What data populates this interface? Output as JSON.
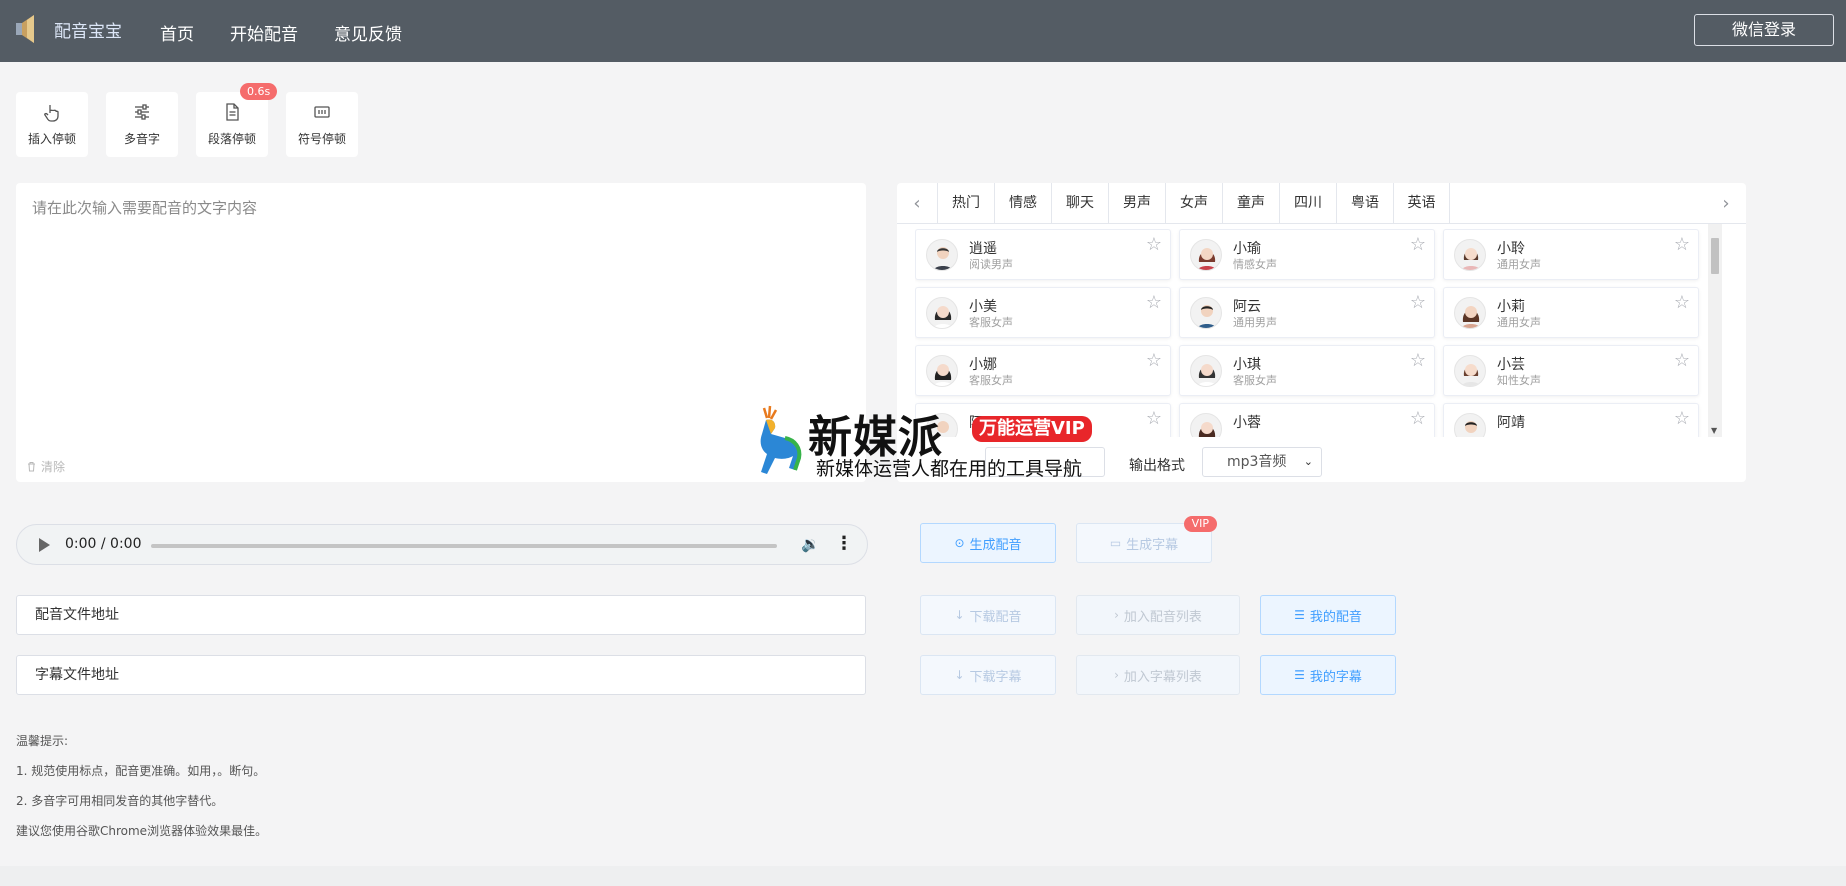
{
  "app": {
    "name": "配音宝宝",
    "nav": [
      "首页",
      "开始配音",
      "意见反馈"
    ],
    "login_label": "微信登录"
  },
  "tools": [
    {
      "label": "插入停顿",
      "icon": "hand-pointer-icon"
    },
    {
      "label": "多音字",
      "icon": "sliders-icon"
    },
    {
      "label": "段落停顿",
      "icon": "document-icon",
      "badge": "0.6s"
    },
    {
      "label": "符号停顿",
      "icon": "symbol-box-icon"
    }
  ],
  "editor": {
    "placeholder": "请在此次输入需要配音的文字内容",
    "clear_label": "清除"
  },
  "voice_tabs": [
    "热门",
    "情感",
    "聊天",
    "男声",
    "女声",
    "童声",
    "四川",
    "粤语",
    "英语"
  ],
  "voices": [
    {
      "name": "逍遥",
      "type": "阅读男声"
    },
    {
      "name": "小瑜",
      "type": "情感女声"
    },
    {
      "name": "小聆",
      "type": "通用女声"
    },
    {
      "name": "小美",
      "type": "客服女声"
    },
    {
      "name": "阿云",
      "type": "通用男声"
    },
    {
      "name": "小莉",
      "type": "通用女声"
    },
    {
      "name": "小娜",
      "type": "客服女声"
    },
    {
      "name": "小琪",
      "type": "客服女声"
    },
    {
      "name": "小芸",
      "type": "知性女声"
    },
    {
      "name": "阿",
      "type": ""
    },
    {
      "name": "小蓉",
      "type": ""
    },
    {
      "name": "阿靖",
      "type": ""
    }
  ],
  "output": {
    "label": "输出格式",
    "selected": "mp3音频"
  },
  "player": {
    "time": "0:00 / 0:00"
  },
  "actions": {
    "generate_audio": "生成配音",
    "generate_subtitle": "生成字幕",
    "subtitle_badge": "VIP",
    "download_audio": "下载配音",
    "add_audio_list": "加入配音列表",
    "my_audio": "我的配音",
    "download_subtitle": "下载字幕",
    "add_subtitle_list": "加入字幕列表",
    "my_subtitle": "我的字幕"
  },
  "fields": {
    "audio_url_placeholder": "配音文件地址",
    "subtitle_url_placeholder": "字幕文件地址"
  },
  "tips": [
    "温馨提示:",
    "1. 规范使用标点，配音更准确。如用，。断句。",
    "2. 多音字可用相同发音的其他字替代。",
    "建议您使用谷歌Chrome浏览器体验效果最佳。"
  ],
  "watermark": {
    "title": "新媒派",
    "tag": "万能运营VIP",
    "subtitle": "新媒体运营人都在用的工具导航"
  },
  "colors": {
    "header": "#545c64",
    "primary": "#409eff",
    "badge": "#f56c6c"
  }
}
